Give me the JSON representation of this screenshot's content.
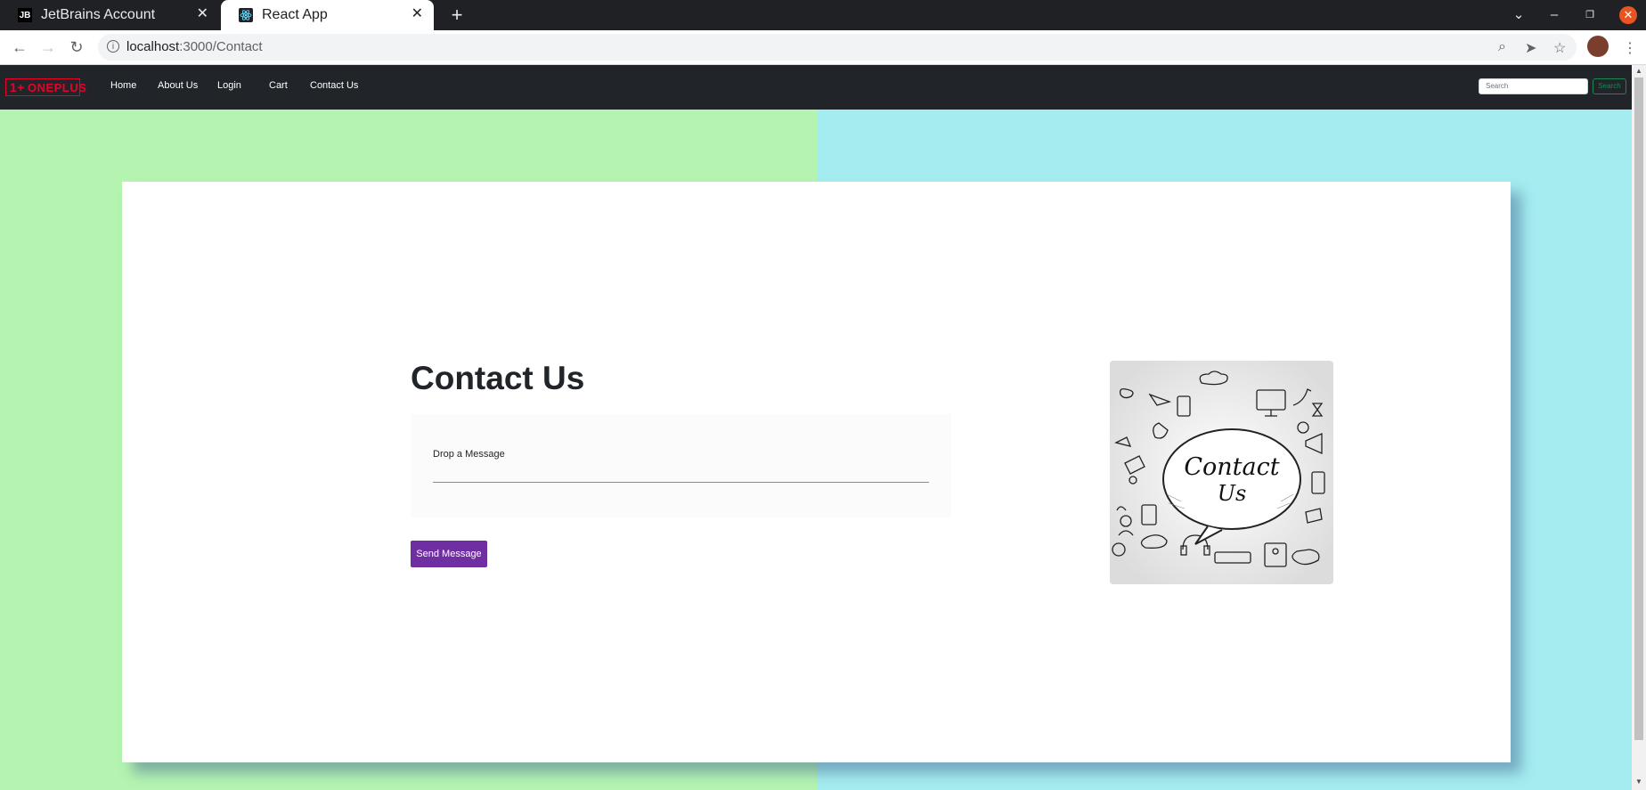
{
  "browser": {
    "tabs": [
      {
        "title": "JetBrains Account",
        "favicon": "JB",
        "active": false
      },
      {
        "title": "React App",
        "favicon": "react-icon",
        "active": true
      }
    ],
    "url_host": "localhost",
    "url_path": ":3000/Contact"
  },
  "navbar": {
    "logo_text": "ONEPLUS",
    "logo_mark": "1+",
    "links": [
      "Home",
      "About Us",
      "Login",
      "Cart",
      "Contact Us"
    ],
    "search_placeholder": "Search",
    "search_button": "Search"
  },
  "contact": {
    "title": "Contact Us",
    "message_label": "Drop a Message",
    "send_button": "Send Message",
    "illustration_text_1": "Contact",
    "illustration_text_2": "Us"
  },
  "colors": {
    "accent": "#6f2ea1",
    "bg_left": "#b4f4b0",
    "bg_right": "#a4ecef",
    "navbar": "#212529"
  }
}
